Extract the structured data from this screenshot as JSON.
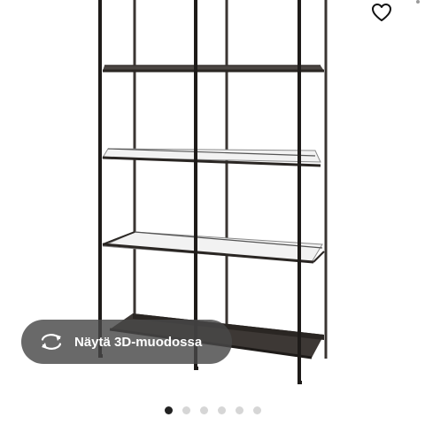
{
  "product": {
    "view_3d_label": "Näytä 3D-muodossa",
    "frame_color": "#2a2623",
    "glass_color": "#8a8a8a"
  },
  "icons": {
    "favorite": "heart-outline-icon",
    "view_3d": "rotate-3d-icon"
  },
  "pager": {
    "total": 6,
    "active_index": 0
  }
}
